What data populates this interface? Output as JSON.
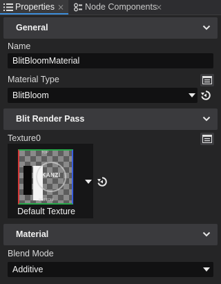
{
  "tabs": [
    {
      "label": "Properties",
      "icon": "list-icon",
      "active": true
    },
    {
      "label": "Node Components",
      "icon": "components-icon",
      "active": false
    }
  ],
  "close_glyph": "⨯",
  "sections": {
    "general": {
      "title": "General"
    },
    "blit_render_pass": {
      "title": "Blit Render Pass"
    },
    "material": {
      "title": "Material"
    }
  },
  "properties": {
    "name": {
      "label": "Name",
      "value": "BlitBloomMaterial"
    },
    "material_type": {
      "label": "Material Type",
      "value": "BlitBloom"
    },
    "texture0": {
      "label": "Texture0",
      "caption": "Default Texture",
      "thumbnail_text": {
        "logo": "KANZI",
        "top": "TOP",
        "bottom": "BOTTOM"
      }
    },
    "blend_mode": {
      "label": "Blend Mode",
      "value": "Additive"
    }
  },
  "colors": {
    "panel_bg": "#252526",
    "section_header_bg": "#3a3a3d",
    "field_bg": "#111112",
    "active_tab_underline": "#3c8cd8"
  }
}
